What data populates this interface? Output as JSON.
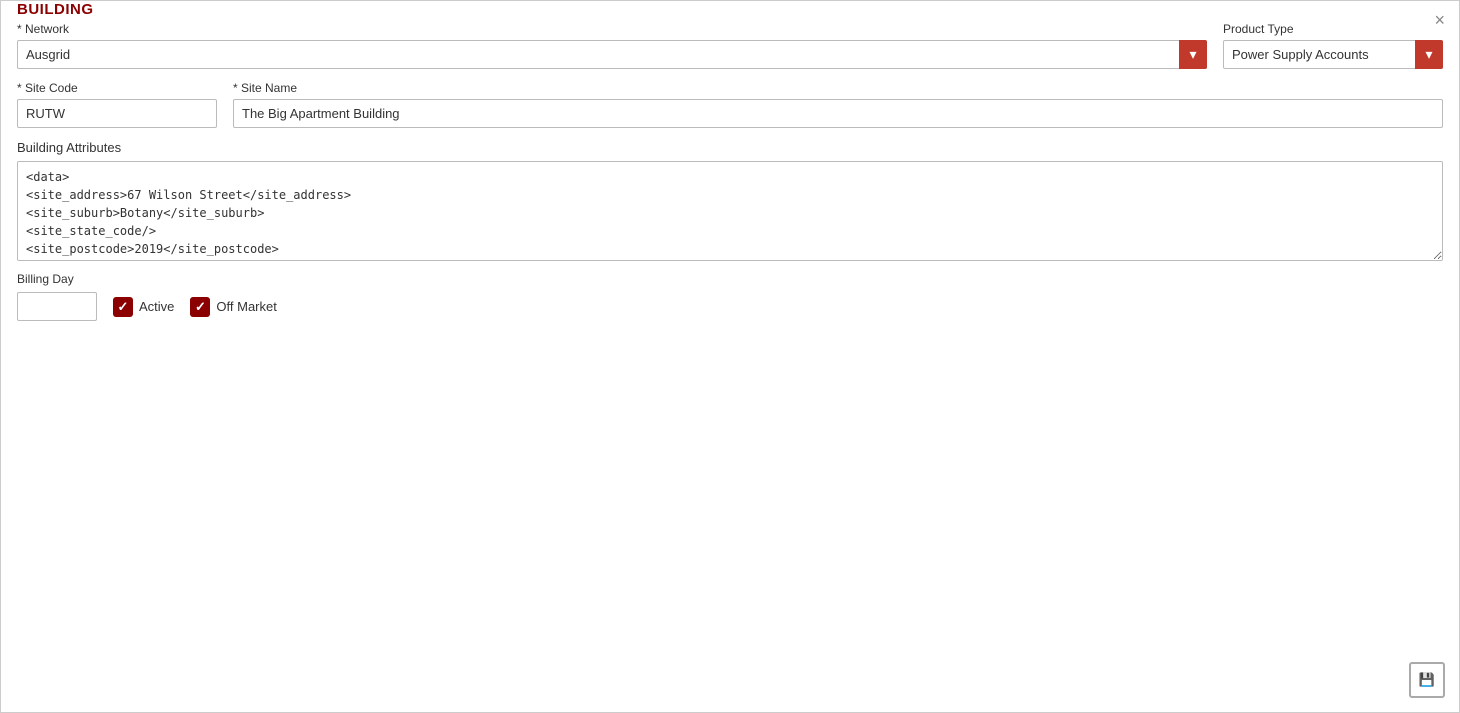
{
  "dialog": {
    "title": "BUILDING",
    "close_icon": "×"
  },
  "form": {
    "network": {
      "label": "* Network",
      "required": true,
      "value": "Ausgrid",
      "options": [
        "Ausgrid"
      ]
    },
    "product_type": {
      "label": "Product Type",
      "value": "Power Supply Accounts",
      "options": [
        "Power Supply Accounts"
      ]
    },
    "site_code": {
      "label": "* Site Code",
      "required": true,
      "value": "RUTW",
      "placeholder": ""
    },
    "site_name": {
      "label": "* Site Name",
      "required": true,
      "value": "The Big Apartment Building",
      "placeholder": ""
    },
    "building_attributes": {
      "label": "Building Attributes",
      "value": "<data>\n<site_address>67 Wilson Street</site_address>\n<site_suburb>Botany</site_suburb>\n<site_state_code/>\n<site_postcode>2019</site_postcode>"
    },
    "billing_day": {
      "label": "Billing Day",
      "value": ""
    },
    "active": {
      "label": "Active",
      "checked": true
    },
    "off_market": {
      "label": "Off Market",
      "checked": true
    }
  },
  "buttons": {
    "save_icon": "💾"
  }
}
